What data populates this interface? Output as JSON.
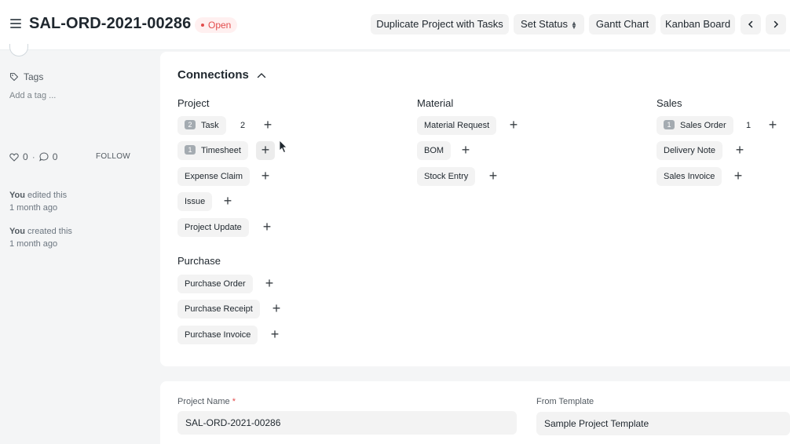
{
  "header": {
    "title": "SAL-ORD-2021-00286",
    "status": "Open",
    "buttons": {
      "duplicate": "Duplicate Project with Tasks",
      "set_status": "Set Status",
      "gantt": "Gantt Chart",
      "kanban": "Kanban Board"
    }
  },
  "sidebar": {
    "tags_label": "Tags",
    "add_tag": "Add a tag ...",
    "likes": "0",
    "comments": "0",
    "follow": "FOLLOW",
    "activity": [
      {
        "who": "You",
        "action": "edited this",
        "when": "1 month ago"
      },
      {
        "who": "You",
        "action": "created this",
        "when": "1 month ago"
      }
    ]
  },
  "connections": {
    "title": "Connections",
    "groups": {
      "project": {
        "label": "Project",
        "items": [
          {
            "label": "Task",
            "badge": "2",
            "count": "2"
          },
          {
            "label": "Timesheet",
            "badge": "1"
          },
          {
            "label": "Expense Claim"
          },
          {
            "label": "Issue"
          },
          {
            "label": "Project Update"
          }
        ]
      },
      "material": {
        "label": "Material",
        "items": [
          {
            "label": "Material Request"
          },
          {
            "label": "BOM"
          },
          {
            "label": "Stock Entry"
          }
        ]
      },
      "sales": {
        "label": "Sales",
        "items": [
          {
            "label": "Sales Order",
            "badge": "1",
            "count": "1"
          },
          {
            "label": "Delivery Note"
          },
          {
            "label": "Sales Invoice"
          }
        ]
      },
      "purchase": {
        "label": "Purchase",
        "items": [
          {
            "label": "Purchase Order"
          },
          {
            "label": "Purchase Receipt"
          },
          {
            "label": "Purchase Invoice"
          }
        ]
      }
    }
  },
  "form": {
    "project_name_label": "Project Name",
    "project_name_required": "*",
    "project_name_value": "SAL-ORD-2021-00286",
    "from_template_label": "From Template",
    "from_template_value": "Sample Project Template"
  },
  "colors": {
    "status_red": "#e24c4c",
    "pill_bg": "#f3f3f3",
    "badge_gray": "#a4abb1"
  }
}
